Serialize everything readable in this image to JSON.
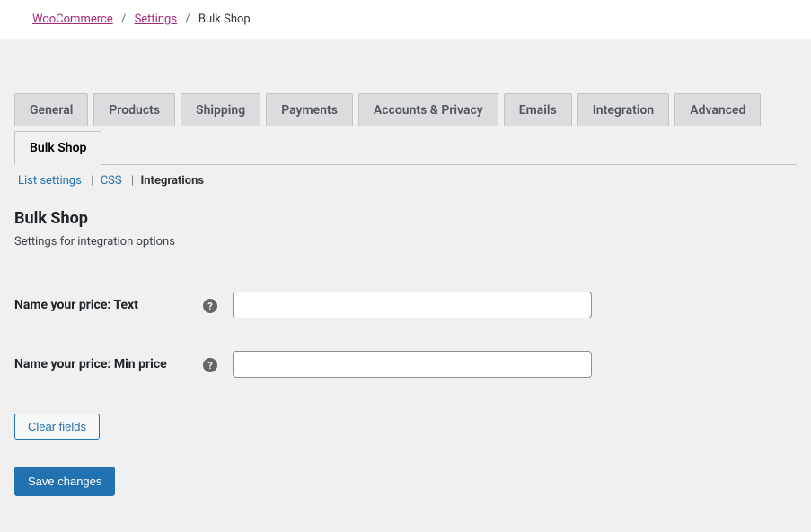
{
  "breadcrumb": {
    "items": [
      {
        "label": "WooCommerce",
        "link": true
      },
      {
        "label": "Settings",
        "link": true
      },
      {
        "label": "Bulk Shop",
        "link": false
      }
    ]
  },
  "tabs": [
    {
      "label": "General",
      "active": false
    },
    {
      "label": "Products",
      "active": false
    },
    {
      "label": "Shipping",
      "active": false
    },
    {
      "label": "Payments",
      "active": false
    },
    {
      "label": "Accounts & Privacy",
      "active": false
    },
    {
      "label": "Emails",
      "active": false
    },
    {
      "label": "Integration",
      "active": false
    },
    {
      "label": "Advanced",
      "active": false
    },
    {
      "label": "Bulk Shop",
      "active": true
    }
  ],
  "subtabs": [
    {
      "label": "List settings",
      "active": false
    },
    {
      "label": "CSS",
      "active": false
    },
    {
      "label": "Integrations",
      "active": true
    }
  ],
  "section": {
    "title": "Bulk Shop",
    "description": "Settings for integration options"
  },
  "form": {
    "fields": [
      {
        "label": "Name your price: Text",
        "value": ""
      },
      {
        "label": "Name your price: Min price",
        "value": ""
      }
    ],
    "clear_label": "Clear fields",
    "save_label": "Save changes"
  },
  "help_glyph": "?"
}
